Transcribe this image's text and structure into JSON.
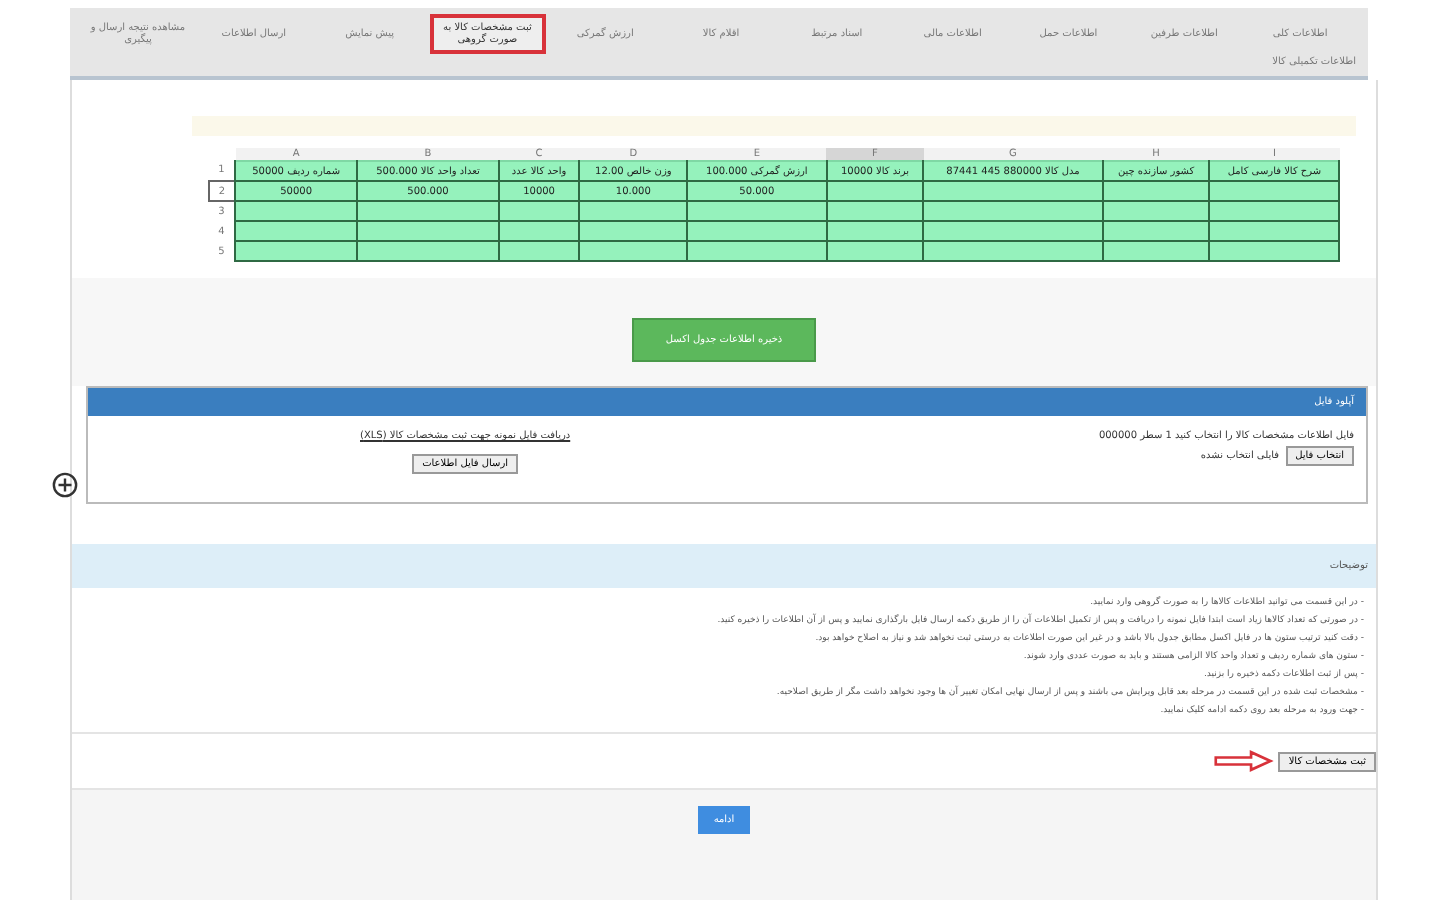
{
  "tabs": [
    {
      "label": "اطلاعات کلی",
      "selected": false
    },
    {
      "label": "اطلاعات طرفین",
      "selected": false
    },
    {
      "label": "اطلاعات حمل",
      "selected": false
    },
    {
      "label": "اطلاعات مالی",
      "selected": false
    },
    {
      "label": "اسناد مرتبط",
      "selected": false
    },
    {
      "label": "اقلام کالا",
      "selected": false
    },
    {
      "label": "ارزش گمرکی",
      "selected": false
    },
    {
      "label": "ثبت مشخصات کالا به صورت گروهی",
      "selected": true
    },
    {
      "label": "پیش نمایش",
      "selected": false
    },
    {
      "label": "ارسال اطلاعات",
      "selected": false
    },
    {
      "label": "مشاهده نتیجه ارسال و پیگیری",
      "selected": false
    }
  ],
  "sub_label": "اطلاعات تکمیلی کالا",
  "sheet": {
    "columns": [
      {
        "label": "I",
        "selected": false
      },
      {
        "label": "H",
        "selected": false
      },
      {
        "label": "G",
        "selected": false
      },
      {
        "label": "F",
        "selected": true
      },
      {
        "label": "E",
        "selected": false
      },
      {
        "label": "D",
        "selected": false
      },
      {
        "label": "C",
        "selected": false
      },
      {
        "label": "B",
        "selected": false
      },
      {
        "label": "A",
        "selected": false
      }
    ],
    "rows": [
      {
        "number": "1",
        "selected": false,
        "cells": [
          "شرح کالا فارسی کامل",
          "کشور سازنده چین",
          "مدل کالا 880000 445 87441",
          "برند کالا 10000",
          "ارزش گمرکی 100.000",
          "وزن خالص 12.00",
          "واحد کالا عدد",
          "تعداد واحد کالا 500.000",
          "شماره ردیف 50000"
        ]
      },
      {
        "number": "2",
        "selected": true,
        "cells": [
          "",
          "",
          "",
          "",
          "50.000",
          "10.000",
          "10000",
          "500.000",
          "50000"
        ]
      },
      {
        "number": "3",
        "selected": false,
        "cells": [
          "",
          "",
          "",
          "",
          "",
          "",
          "",
          "",
          ""
        ]
      },
      {
        "number": "4",
        "selected": false,
        "cells": [
          "",
          "",
          "",
          "",
          "",
          "",
          "",
          "",
          ""
        ]
      },
      {
        "number": "5",
        "selected": false,
        "cells": [
          "",
          "",
          "",
          "",
          "",
          "",
          "",
          "",
          ""
        ]
      }
    ]
  },
  "save_button": "ذخیره اطلاعات جدول اکسل",
  "upload_panel": {
    "title": "آپلود فایل",
    "info": "فایل اطلاعات مشخصات کالا را انتخاب کنید 1 سطر 000000",
    "file_button": "انتخاب فایل",
    "file_status": "فایلی انتخاب نشده",
    "link": "دریافت فایل نمونه جهت ثبت مشخصات کالا (XLS)",
    "upload_button": "ارسال فایل اطلاعات"
  },
  "notes": {
    "title": "توضیحات",
    "lines": [
      "- در این قسمت می توانید اطلاعات کالاها را به صورت گروهی وارد نمایید.",
      "- در صورتی که تعداد کالاها زیاد است ابتدا فایل نمونه را دریافت و پس از تکمیل اطلاعات آن را از طریق دکمه ارسال فایل بارگذاری نمایید و پس از آن اطلاعات را ذخیره کنید.",
      "- دقت کنید ترتیب ستون ها در فایل اکسل مطابق جدول بالا باشد و در غیر این صورت اطلاعات به درستی ثبت نخواهد شد و نیاز به اصلاح خواهد بود.",
      "- ستون های شماره ردیف و تعداد واحد کالا الزامی هستند و باید به صورت عددی وارد شوند.",
      "- پس از ثبت اطلاعات دکمه ذخیره را بزنید.",
      "- مشخصات ثبت شده در این قسمت در مرحله بعد قابل ویرایش می باشند و پس از ارسال نهایی امکان تغییر آن ها وجود نخواهد داشت مگر از طریق اصلاحیه.",
      "- جهت ورود به مرحله بعد روی دکمه ادامه کلیک نمایید."
    ]
  },
  "next_step_button": "ثبت مشخصات کالا",
  "continue_button": "ادامه"
}
